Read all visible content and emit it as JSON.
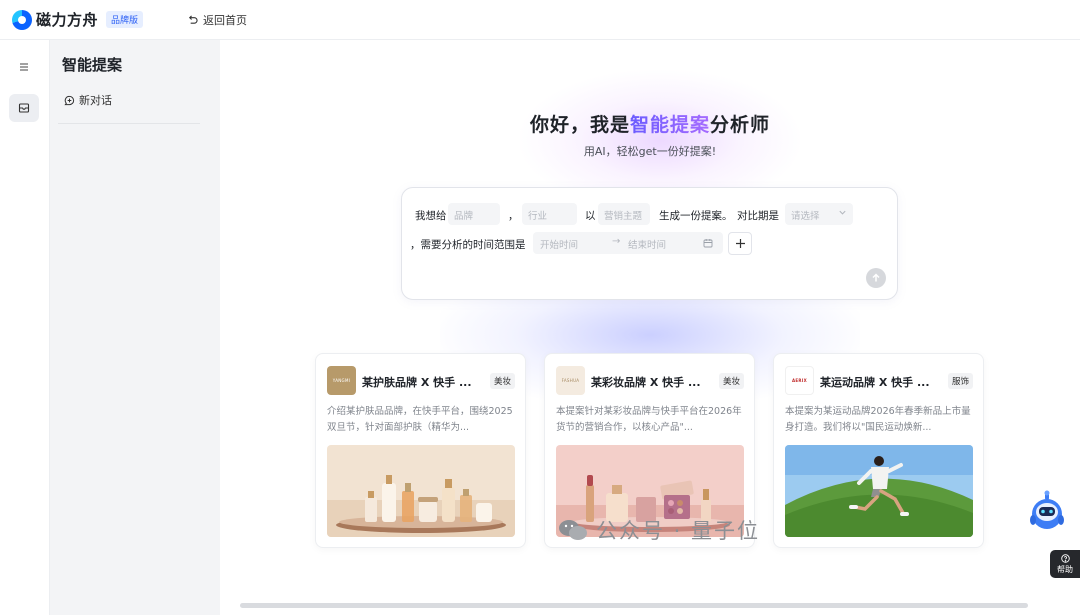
{
  "topbar": {
    "logo_text": "磁力方舟",
    "edition_badge": "品牌版",
    "back_label": "返回首页"
  },
  "sidebar": {
    "title": "智能提案",
    "new_chat_label": "新对话"
  },
  "hero": {
    "title_prefix": "你好，我是",
    "title_accent": "智能提案",
    "title_suffix": "分析师",
    "subtitle": "用AI，轻松get一份好提案!"
  },
  "prompt": {
    "text_1": "我想给",
    "brand_placeholder": "品牌",
    "comma_1": "，",
    "industry_placeholder": "行业",
    "text_2": "以",
    "topic_placeholder": "营销主题",
    "text_3": "生成一份提案。",
    "text_4": "对比期是",
    "compare_placeholder": "请选择",
    "text_5": "，需要分析的时间范围是",
    "start_placeholder": "开始时间",
    "end_placeholder": "结束时间"
  },
  "cards": [
    {
      "logo_text": "YANGMI",
      "title": "某护肤品牌 X 快手 ...",
      "tag": "美妆",
      "desc": "介绍某护肤品品牌，在快手平台，围绕2025双旦节，针对面部护肤（精华为..."
    },
    {
      "logo_text": "FASHUA",
      "title": "某彩妆品牌 X 快手 ...",
      "tag": "美妆",
      "desc": "本提案针对某彩妆品牌与快手平台在2026年货节的营销合作，以核心产品\"..."
    },
    {
      "logo_text": "AERIX",
      "title": "某运动品牌 X 快手 ...",
      "tag": "服饰",
      "desc": "本提案为某运动品牌2026年春季新品上市量身打造。我们将以\"国民运动焕新..."
    }
  ],
  "watermark": {
    "text": "公众号 · 量子位"
  },
  "help": {
    "label": "帮助"
  },
  "colors": {
    "accent_gradient_start": "#6b5cff",
    "accent_gradient_end": "#a66bff",
    "badge_blue": "#2b5ff5"
  }
}
